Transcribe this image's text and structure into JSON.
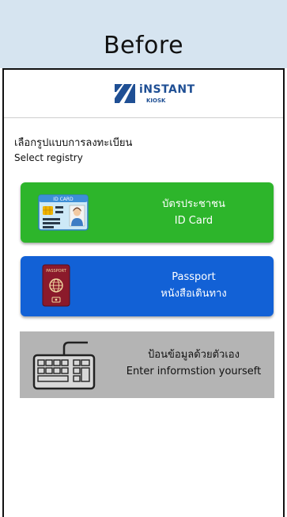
{
  "banner": {
    "title": "Before"
  },
  "header": {
    "logo_text": "iNSTANT",
    "logo_sub": "KIOSK"
  },
  "prompt": {
    "thai": "เลือกรูปแบบการลงทะเบียน",
    "english": "Select registry"
  },
  "options": [
    {
      "line1": "บัตรประชาชน",
      "line2": "ID Card",
      "icon": "id-card-icon",
      "color": "#2db52b",
      "icon_label": "ID CARD"
    },
    {
      "line1": "Passport",
      "line2": "หนังสือเดินทาง",
      "icon": "passport-icon",
      "color": "#1261d6",
      "icon_label": "PASSPORT"
    },
    {
      "line1": "ป้อนข้อมูลด้วยตัวเอง",
      "line2": "Enter informstion yourseft",
      "icon": "keyboard-icon",
      "color": "#b4b4b4"
    }
  ]
}
